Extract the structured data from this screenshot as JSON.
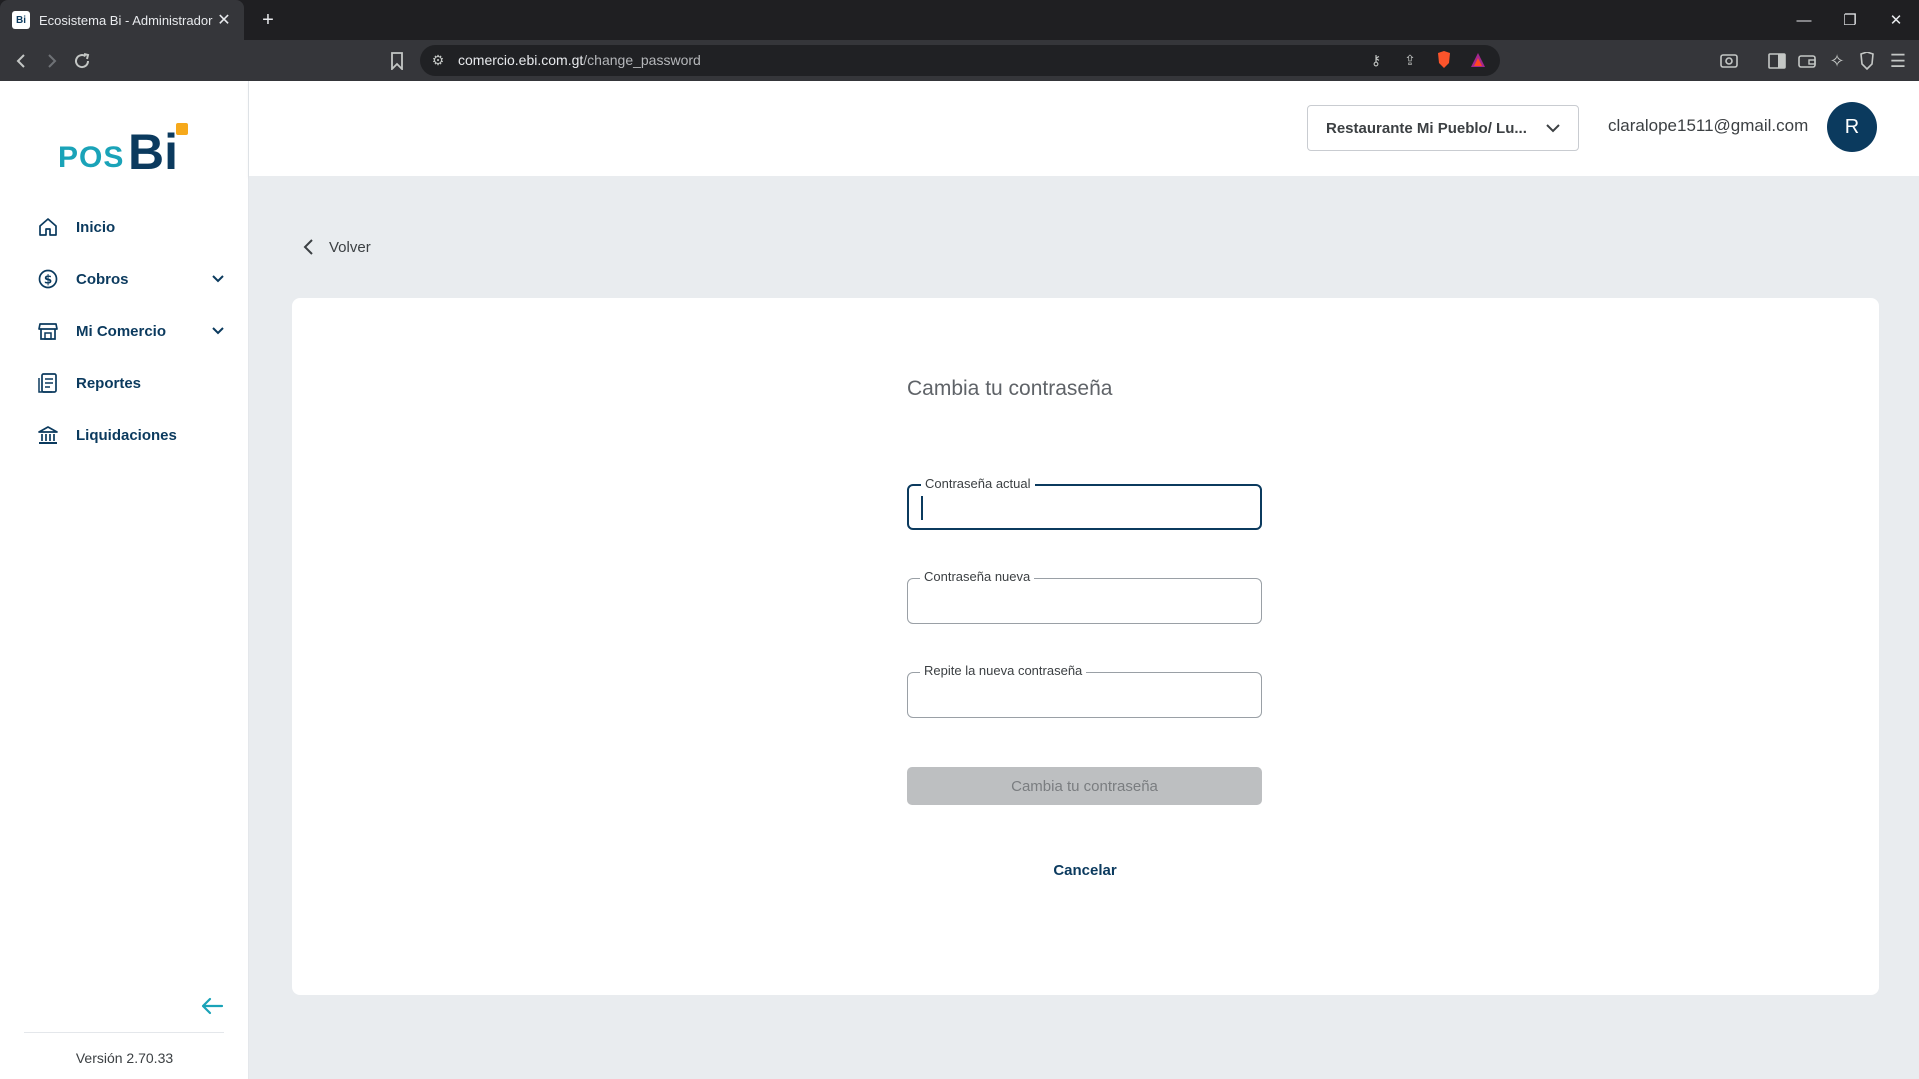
{
  "browser": {
    "tab_title": "Ecosistema Bi - Administrador",
    "favicon_text": "Bi",
    "url_domain": "comercio.ebi.com.gt",
    "url_path": "/change_password"
  },
  "sidebar": {
    "logo": {
      "pos": "POS",
      "bi": "Bi"
    },
    "items": [
      {
        "label": "Inicio",
        "icon": "home-icon",
        "has_submenu": false
      },
      {
        "label": "Cobros",
        "icon": "payments-icon",
        "has_submenu": true
      },
      {
        "label": "Mi Comercio",
        "icon": "store-icon",
        "has_submenu": true
      },
      {
        "label": "Reportes",
        "icon": "reports-icon",
        "has_submenu": false
      },
      {
        "label": "Liquidaciones",
        "icon": "bank-icon",
        "has_submenu": false
      }
    ],
    "version": "Versión 2.70.33"
  },
  "header": {
    "store_selector": "Restaurante Mi Pueblo/ Lu...",
    "user_email": "claralope1511@gmail.com",
    "avatar_initial": "R"
  },
  "main": {
    "back_label": "Volver",
    "form_title": "Cambia tu contraseña",
    "fields": {
      "current": {
        "label": "Contraseña actual",
        "value": ""
      },
      "new": {
        "label": "Contraseña nueva",
        "value": ""
      },
      "repeat": {
        "label": "Repite la nueva contraseña",
        "value": ""
      }
    },
    "submit_label": "Cambia tu contraseña",
    "cancel_label": "Cancelar"
  },
  "colors": {
    "brand_navy": "#0b3a5e",
    "brand_teal": "#1aa3b8",
    "brand_orange": "#f6a91b",
    "disabled_button": "#bdbfc1"
  }
}
